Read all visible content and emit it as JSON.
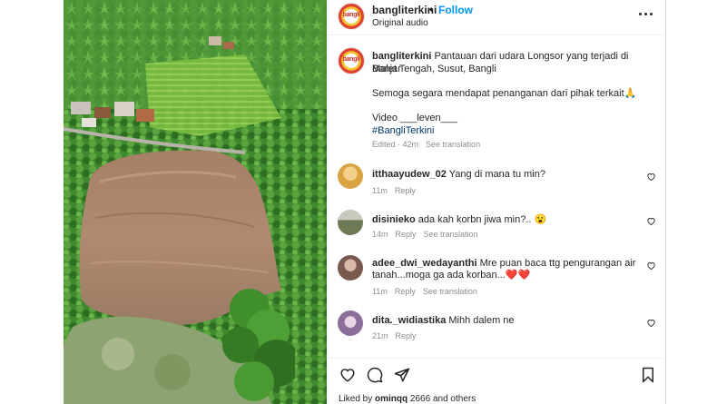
{
  "post": {
    "username": "bangliterkini",
    "separator": "•",
    "follow_label": "Follow",
    "audio": "Original audio",
    "avatar_text": "bangli"
  },
  "caption": {
    "username": "bangliterkini",
    "line1_rest": " Pantauan dari udara Longsor yang terjadi di Banjar",
    "line2": "Malet Tengah, Susut, Bangli",
    "line3": "Semoga segara mendapat penanganan dari pihak terkait🙏",
    "line4": "Video ___leven___",
    "hashtag": "#BangliTerkini",
    "time": "Edited · 42m",
    "see_translation": "See translation"
  },
  "comments": [
    {
      "username": "itthaayudew_02",
      "text": " Yang di mana tu min?",
      "text2": "",
      "time": "11m",
      "reply": "Reply",
      "translation": "",
      "avatar_color": "#d9a441"
    },
    {
      "username": "disinieko",
      "text": " ada kah korbn jiwa min?.. 😮",
      "text2": "",
      "time": "14m",
      "reply": "Reply",
      "translation": "See translation",
      "avatar_color": "#6d7a55"
    },
    {
      "username": "adee_dwi_wedayanthi",
      "text": " Mre puan baca ttg pengurangan air",
      "text2": "tanah...moga ga ada korban...❤️❤️",
      "time": "11m",
      "reply": "Reply",
      "translation": "See translation",
      "avatar_color": "#7a5a4e"
    },
    {
      "username": "dita._widiastika",
      "text": " Mihh dalem ne",
      "text2": "",
      "time": "21m",
      "reply": "Reply",
      "translation": "",
      "avatar_color": "#8a6f9a"
    }
  ],
  "footer": {
    "liked_by_prefix": "Liked by ",
    "liked_by_user": "ominqq",
    "liked_by_middle": " 2666",
    "liked_by_suffix": " and others"
  }
}
